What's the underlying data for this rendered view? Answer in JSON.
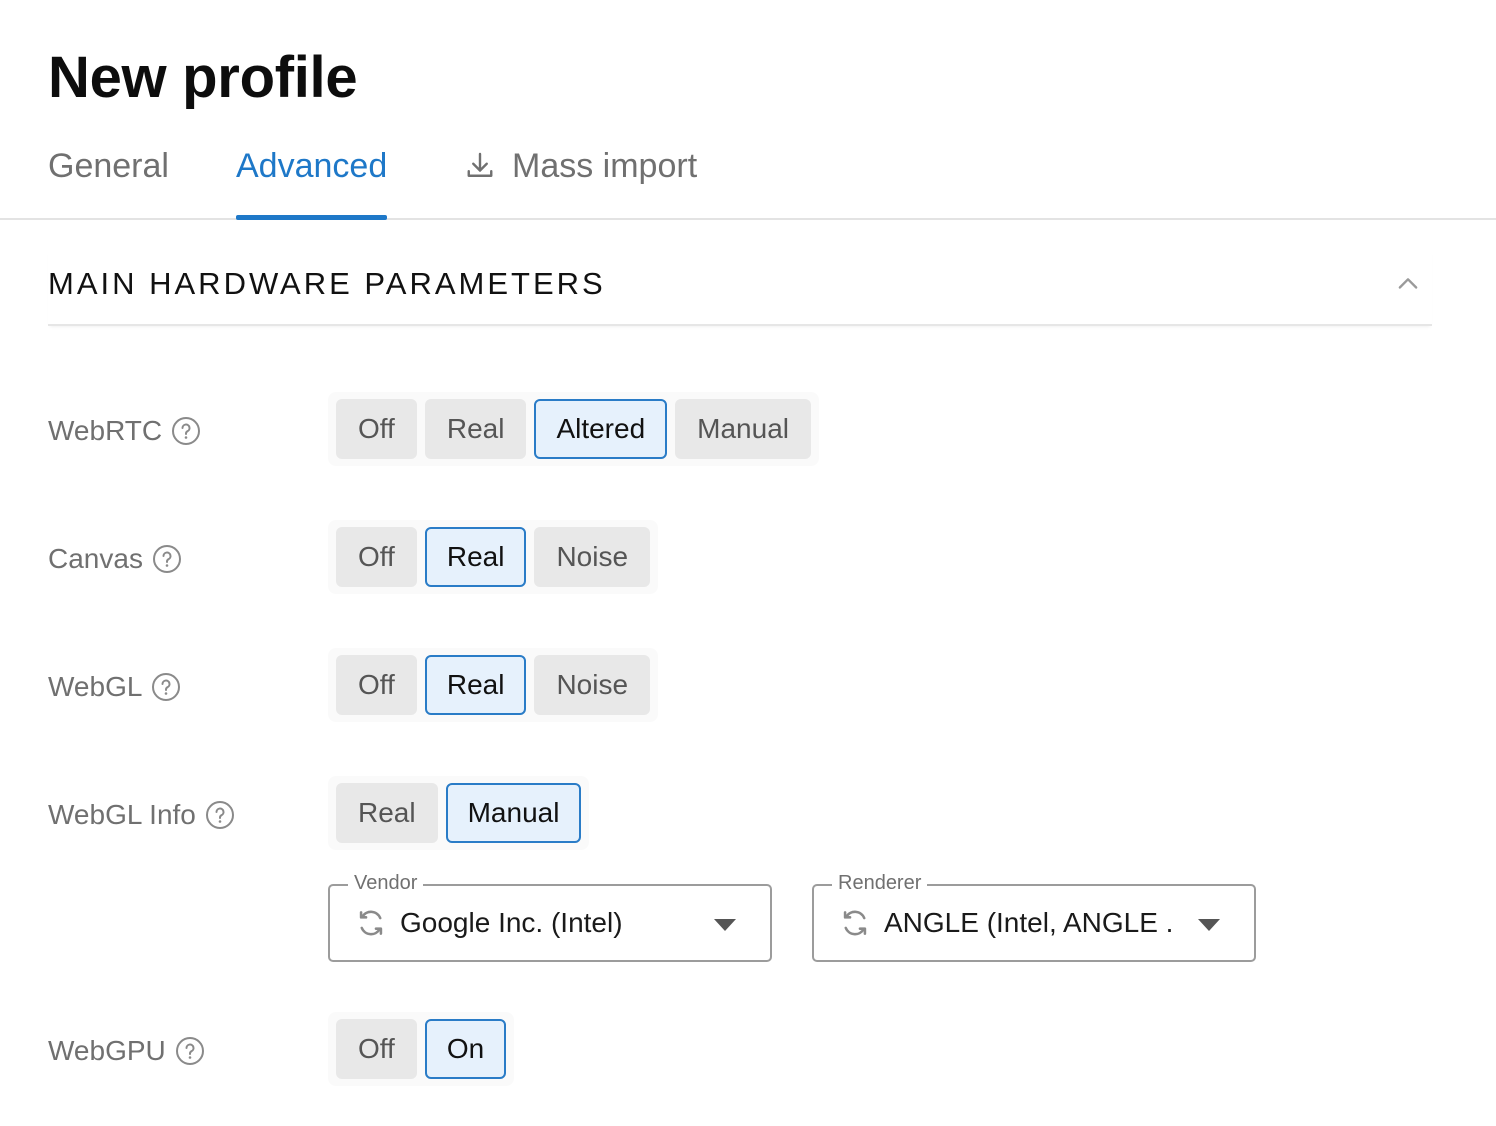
{
  "page": {
    "title": "New profile"
  },
  "tabs": [
    {
      "label": "General",
      "active": false
    },
    {
      "label": "Advanced",
      "active": true
    },
    {
      "label": "Mass import",
      "active": false,
      "icon": "download-icon"
    }
  ],
  "section": {
    "title": "MAIN HARDWARE PARAMETERS",
    "collapse_icon": "chevron-up-icon"
  },
  "rows": {
    "webrtc": {
      "label": "WebRTC",
      "options": [
        "Off",
        "Real",
        "Altered",
        "Manual"
      ],
      "selected": "Altered"
    },
    "canvas": {
      "label": "Canvas",
      "options": [
        "Off",
        "Real",
        "Noise"
      ],
      "selected": "Real"
    },
    "webgl": {
      "label": "WebGL",
      "options": [
        "Off",
        "Real",
        "Noise"
      ],
      "selected": "Real"
    },
    "webgl_info": {
      "label": "WebGL Info",
      "options": [
        "Real",
        "Manual"
      ],
      "selected": "Manual",
      "vendor": {
        "legend": "Vendor",
        "value": "Google Inc. (Intel)"
      },
      "renderer": {
        "legend": "Renderer",
        "value": "ANGLE (Intel, ANGLE ..."
      }
    },
    "webgpu": {
      "label": "WebGPU",
      "options": [
        "Off",
        "On"
      ],
      "selected": "On"
    }
  },
  "colors": {
    "accent": "#1e78c8",
    "active_bg": "#e6f1fc",
    "button_bg": "#e8e8e8",
    "muted_text": "#707070"
  }
}
